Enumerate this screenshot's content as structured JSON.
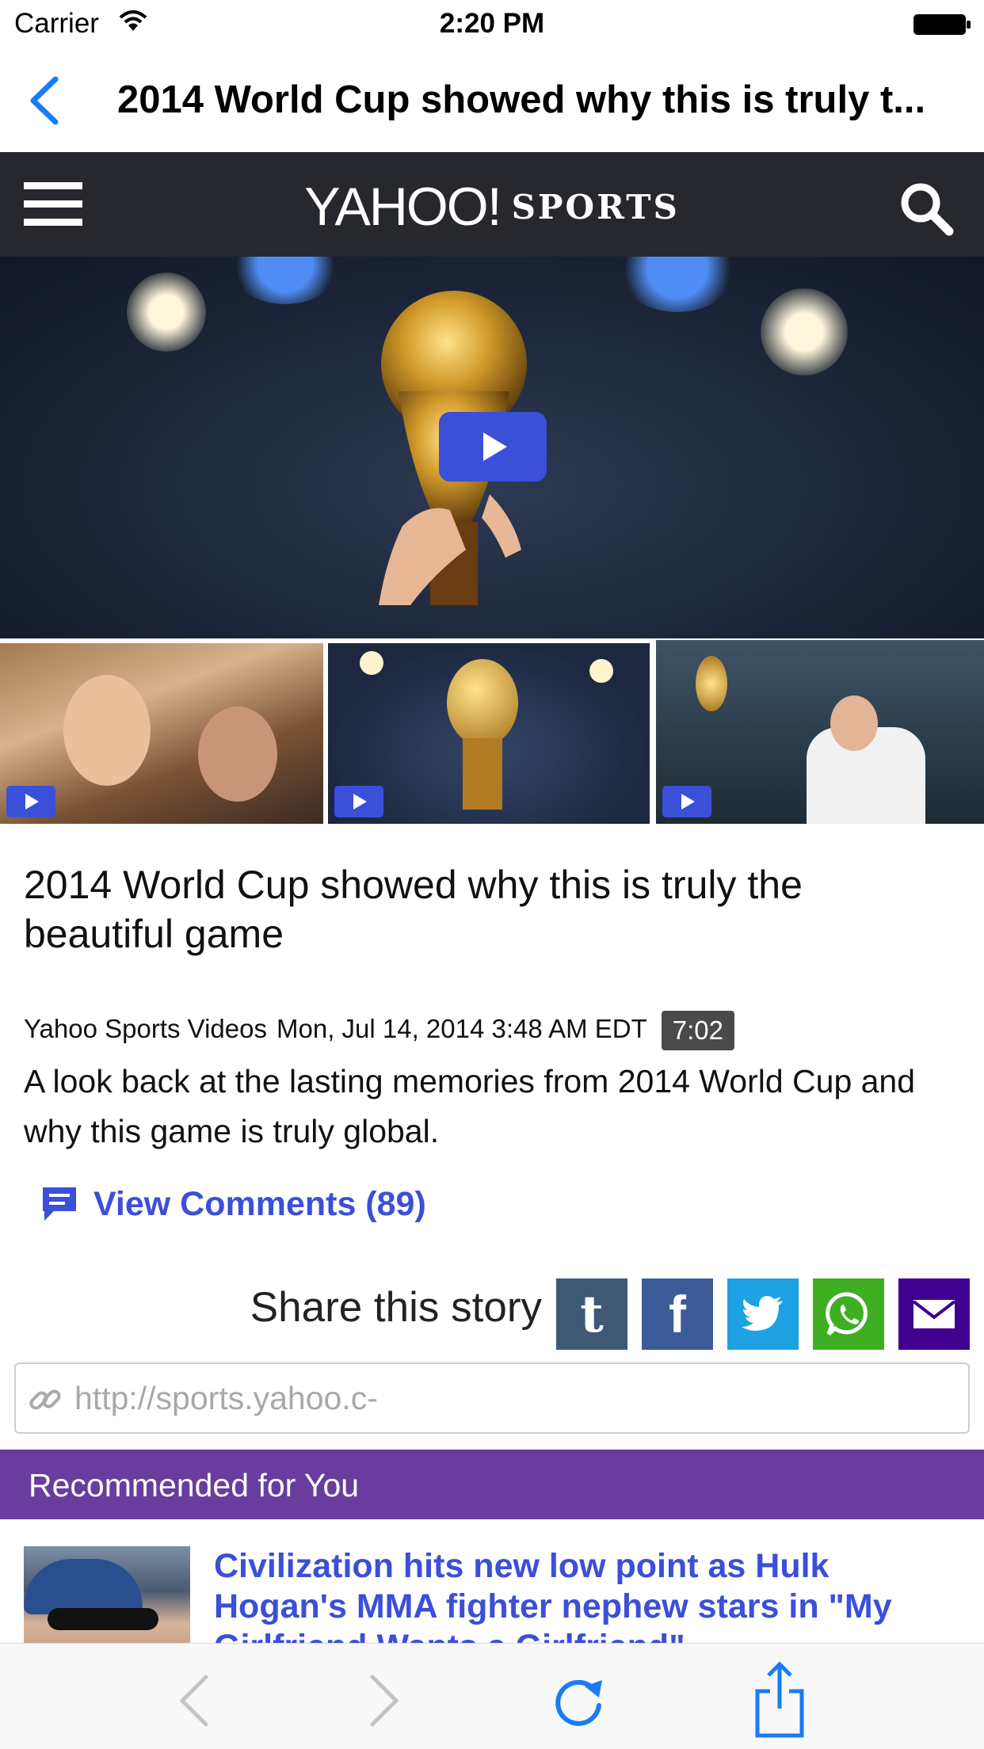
{
  "status_bar": {
    "carrier": "Carrier",
    "time": "2:20 PM"
  },
  "nav": {
    "title": "2014 World Cup showed why this is truly t..."
  },
  "header": {
    "logo_word": "YAHOO!",
    "logo_section": "SPORTS"
  },
  "video": {
    "selected_index": 2,
    "thumbnail_count": 3
  },
  "article": {
    "headline": "2014 World Cup showed why this is truly the beautiful game",
    "source": "Yahoo Sports Videos",
    "date": "Mon, Jul 14, 2014 3:48 AM EDT",
    "duration": "7:02",
    "summary": "A look back at the lasting memories from 2014 World Cup and why this game is truly global.",
    "comments_label": "View Comments (89)"
  },
  "share": {
    "label": "Share this story",
    "tumblr_glyph": "t",
    "facebook_glyph": "f",
    "url_value": "http://sports.yahoo.c-"
  },
  "recommended": {
    "title": "Recommended for You",
    "items": [
      {
        "headline": "Civilization hits new low point as Hulk Hogan's MMA fighter nephew stars in \"My Girlfriend Wants a Girlfriend\""
      }
    ]
  },
  "colors": {
    "accent_blue": "#3b4fd8",
    "ios_blue": "#1a7cf5",
    "header_dark": "#26282e",
    "recommended_purple": "#6a3c9e",
    "tumblr": "#3f5975",
    "facebook": "#3d5b99",
    "twitter": "#1da1e2",
    "whatsapp": "#3fae23",
    "email": "#400090"
  },
  "icons": [
    "wifi-icon",
    "battery-icon",
    "back-chevron-icon",
    "menu-icon",
    "search-icon",
    "play-icon",
    "comment-icon",
    "link-icon",
    "twitter-bird-icon",
    "whatsapp-icon",
    "email-icon",
    "reload-icon",
    "share-icon"
  ]
}
